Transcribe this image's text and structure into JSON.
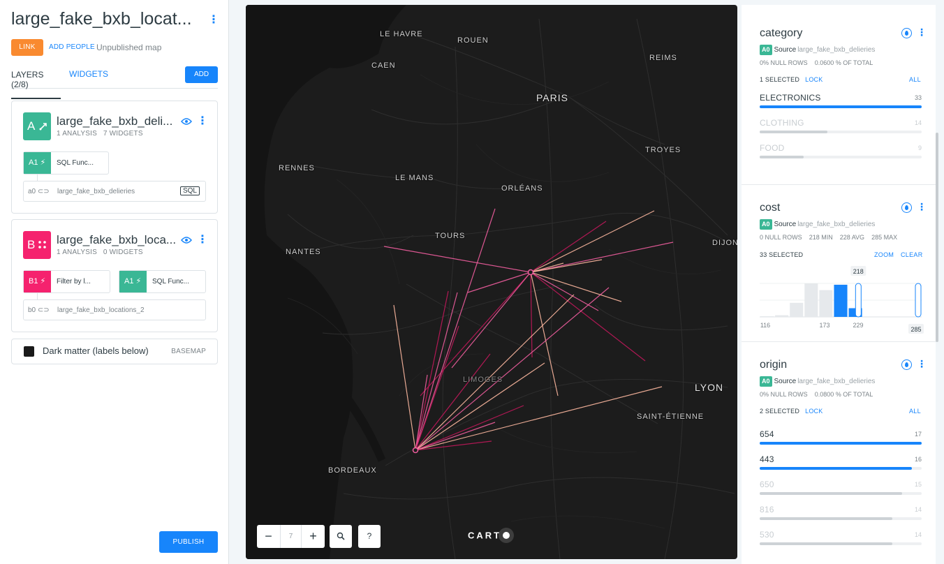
{
  "app": {
    "map_title": "large_fake_bxb_locat...",
    "link_label": "LINK",
    "add_people_label": "ADD PEOPLE",
    "status": "Unpublished map"
  },
  "tabs": {
    "layers": "LAYERS (2/8)",
    "widgets": "WIDGETS",
    "add": "ADD"
  },
  "layers": [
    {
      "letter": "A",
      "name": "large_fake_bxb_deli...",
      "analyses": "1 ANALYSIS",
      "widgets": "7 WIDGETS",
      "color": "#3ab795",
      "steps": [
        {
          "id": "A1",
          "label": "SQL Func..."
        }
      ],
      "source": {
        "id": "a0",
        "name": "large_fake_bxb_delieries",
        "tag": "SQL"
      }
    },
    {
      "letter": "B",
      "name": "large_fake_bxb_loca...",
      "analyses": "1 ANALYSIS",
      "widgets": "0 WIDGETS",
      "color": "#f5226e",
      "steps": [
        {
          "id": "B1",
          "label": "Filter by l..."
        },
        {
          "id": "A1",
          "label": "SQL Func..."
        }
      ],
      "source": {
        "id": "b0",
        "name": "large_fake_bxb_locations_2"
      }
    }
  ],
  "basemap": {
    "name": "Dark matter (labels below)",
    "tag": "BASEMAP"
  },
  "publish_label": "PUBLISH",
  "map": {
    "zoom_level": "7",
    "zoom_out": "−",
    "zoom_in": "+",
    "search": "🔍",
    "help": "?",
    "carto_label": "CART",
    "cities": [
      "LE HAVRE",
      "ROUEN",
      "CAEN",
      "PARIS",
      "REIMS",
      "TROYES",
      "RENNES",
      "LE MANS",
      "ORLÉANS",
      "TOURS",
      "NANTES",
      "DIJON",
      "LIMOGES",
      "LYON",
      "SAINT-ÉTIENNE",
      "BORDEAUX"
    ],
    "flow_colors": [
      "#ffb9a1",
      "#f25ea0",
      "#c2185b"
    ]
  },
  "widgets": {
    "category": {
      "title": "category",
      "node": "A0",
      "source_label": "Source",
      "source_name": "large_fake_bxb_delieries",
      "null_rows": "0% NULL ROWS",
      "of_total": "0.0600 % OF TOTAL",
      "selected": "1 SELECTED",
      "lock": "LOCK",
      "all": "ALL",
      "items": [
        {
          "label": "ELECTRONICS",
          "value": "33",
          "ratio": 1.0,
          "on": true
        },
        {
          "label": "CLOTHING",
          "value": "14",
          "ratio": 0.42,
          "on": false
        },
        {
          "label": "FOOD",
          "value": "9",
          "ratio": 0.27,
          "on": false
        }
      ]
    },
    "cost": {
      "title": "cost",
      "node": "A0",
      "source_label": "Source",
      "source_name": "large_fake_bxb_delieries",
      "null_rows": "0 NULL ROWS",
      "min": "218 MIN",
      "avg": "228 AVG",
      "max": "285 MAX",
      "selected": "33 SELECTED",
      "zoom": "ZOOM",
      "clear": "CLEAR",
      "range_low": "218",
      "range_high": "285",
      "ticks": [
        "116",
        "173",
        "229"
      ],
      "bins": [
        0.02,
        0.05,
        0.42,
        1.0,
        0.8,
        0.96,
        0.26,
        0,
        0,
        0,
        0
      ],
      "selected_bins": [
        5,
        6
      ]
    },
    "origin": {
      "title": "origin",
      "node": "A0",
      "source_label": "Source",
      "source_name": "large_fake_bxb_delieries",
      "null_rows": "0% NULL ROWS",
      "of_total": "0.0800 % OF TOTAL",
      "selected": "2 SELECTED",
      "lock": "LOCK",
      "all": "ALL",
      "items": [
        {
          "label": "654",
          "value": "17",
          "ratio": 1.0,
          "on": true
        },
        {
          "label": "443",
          "value": "16",
          "ratio": 0.94,
          "on": true
        },
        {
          "label": "650",
          "value": "15",
          "ratio": 0.88,
          "on": false
        },
        {
          "label": "816",
          "value": "14",
          "ratio": 0.82,
          "on": false
        },
        {
          "label": "530",
          "value": "14",
          "ratio": 0.82,
          "on": false
        }
      ]
    }
  }
}
